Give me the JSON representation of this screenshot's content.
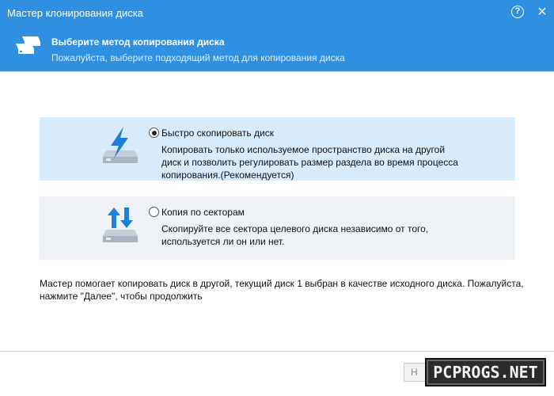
{
  "window": {
    "title": "Мастер клонирования диска",
    "help_icon": "?",
    "close_icon": "×"
  },
  "header": {
    "title": "Выберите метод копирования диска",
    "subtitle": "Пожалуйста, выберите подходящий метод для копирования диска",
    "icon": "disk-copy-icon"
  },
  "options": [
    {
      "icon": "lightning-disk-icon",
      "selected": true,
      "label": "Быстро скопировать диск",
      "description": [
        "Копировать только используемое пространство диска на другой",
        "диск и позволить регулировать размер раздела во время процесса",
        "копирования.(Рекомендуется)"
      ]
    },
    {
      "icon": "arrows-disk-icon",
      "selected": false,
      "label": "Копия по секторам",
      "description": [
        "Скопируйте все сектора целевого диска независимо от того,",
        "используется ли он или нет."
      ]
    }
  ],
  "info": [
    "Мастер помогает копировать диск в другой, текущий диск 1 выбран в качестве исходного диска. Пожалуйста,",
    "нажмите \"Далее\", чтобы продолжить"
  ],
  "footer": {
    "next_label": "Н"
  },
  "watermark": "PCPROGS.NET",
  "colors": {
    "accent": "#2f8fe0",
    "selected_option_bg": "#d8ebfa",
    "option_bg": "#eef1f6",
    "icon_blue": "#1e7fd8",
    "disk_gray": "#b9c3cf"
  }
}
